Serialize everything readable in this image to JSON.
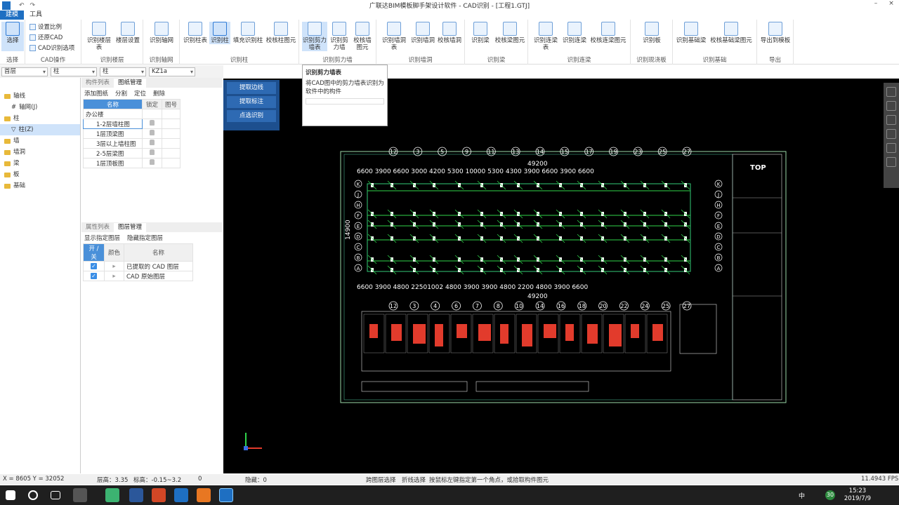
{
  "window": {
    "title": "广联达BIM模板脚手架设计软件 - CAD识别 - [工程1.GTJ]",
    "quick_access": [
      "↶",
      "↷"
    ],
    "controls": [
      "–",
      "×"
    ]
  },
  "menu": {
    "tabs": [
      "建模",
      "工具"
    ]
  },
  "ribbon": {
    "select": {
      "label": "选择",
      "group": "选择"
    },
    "cad_ops": {
      "items": [
        "设置比例",
        "还原CAD",
        "CAD识别选项"
      ],
      "group": "CAD操作"
    },
    "floor": {
      "buttons": [
        "识别楼层表",
        "楼层设置"
      ],
      "group": "识别楼层"
    },
    "axis": {
      "buttons": [
        "识别轴网"
      ],
      "group": "识别轴网"
    },
    "column": {
      "buttons": [
        "识别柱表",
        "识别柱",
        "填充识别柱",
        "校核柱图元"
      ],
      "group": "识别柱"
    },
    "shearwall": {
      "buttons": [
        "识别剪力墙表",
        "识别剪力墙",
        "校核墙图元"
      ],
      "group": "识别剪力墙"
    },
    "wallhole": {
      "buttons": [
        "识别墙洞表",
        "识别墙洞",
        "校核墙洞"
      ],
      "group": "识别墙洞"
    },
    "beam": {
      "buttons": [
        "识别梁",
        "校核梁图元"
      ],
      "group": "识别梁"
    },
    "lianliang": {
      "buttons": [
        "识别连梁表",
        "识别连梁",
        "校核连梁图元"
      ],
      "group": "识别连梁"
    },
    "slab": {
      "buttons": [
        "识别板"
      ],
      "group": "识别现浇板"
    },
    "foundation": {
      "buttons": [
        "识别基础梁",
        "校核基础梁图元"
      ],
      "group": "识别基础"
    },
    "export": {
      "buttons": [
        "导出到模板"
      ],
      "group": "导出"
    }
  },
  "filters": {
    "floor": "首层",
    "type1": "柱",
    "type2": "柱",
    "name": "KZ1a"
  },
  "tree": {
    "items": [
      {
        "label": "轴线",
        "child": false
      },
      {
        "label": "轴网(J)",
        "child": true
      },
      {
        "label": "柱",
        "child": false
      },
      {
        "label": "柱(Z)",
        "child": true,
        "selected": true
      },
      {
        "label": "墙",
        "child": false
      },
      {
        "label": "墙洞",
        "child": false
      },
      {
        "label": "梁",
        "child": false
      },
      {
        "label": "板",
        "child": false
      },
      {
        "label": "基础",
        "child": false
      }
    ]
  },
  "drawing_panel": {
    "tabs": [
      "构件列表",
      "图纸管理"
    ],
    "tools": [
      "添加图纸",
      "分割",
      "定位",
      "删除"
    ],
    "headers": [
      "名称",
      "锁定",
      "图号"
    ],
    "group": "办公楼",
    "rows": [
      "1-2层墙柱图",
      "1层顶梁图",
      "3层以上墙柱图",
      "2-5层梁图",
      "1层顶板图"
    ]
  },
  "layer_panel": {
    "tabs": [
      "属性列表",
      "图层管理"
    ],
    "options": [
      "显示指定图层",
      "隐藏指定图层"
    ],
    "headers": [
      "开 / 关",
      "颜色",
      "名称"
    ],
    "rows": [
      "已提取的 CAD 图层",
      "CAD 原始图层"
    ]
  },
  "float_panel": {
    "buttons": [
      "提取边线",
      "提取标注",
      "点选识别"
    ]
  },
  "tooltip": {
    "title": "识别剪力墙表",
    "body": "将CAD图中的剪力墙表识别为软件中的构件"
  },
  "drawing": {
    "top_axes": [
      "12",
      "3",
      "5",
      "9",
      "11",
      "13",
      "14",
      "15",
      "17",
      "19",
      "23",
      "25",
      "27"
    ],
    "bottom_axes": [
      "12",
      "3",
      "4",
      "6",
      "7",
      "8",
      "10",
      "14",
      "16",
      "18",
      "20",
      "22",
      "24",
      "25",
      "27"
    ],
    "total": "49200",
    "side_axes": [
      "K",
      "J",
      "H",
      "F",
      "E",
      "D",
      "C",
      "B",
      "A"
    ],
    "logo": "TOP",
    "dims": [
      "6600",
      "3900",
      "6600",
      "3000",
      "4200",
      "5300",
      "10000",
      "5300",
      "4300",
      "3900",
      "6600",
      "3900",
      "6600"
    ],
    "dims_bottom": [
      "6600",
      "3900",
      "4800",
      "2250",
      "0",
      "1",
      "0",
      "0",
      "1",
      "0",
      "0",
      "2250",
      "0",
      "4800",
      "3900",
      "3900",
      "4800",
      "2200",
      "0",
      "0",
      "1",
      "0",
      "0",
      "2250",
      "0",
      "4800",
      "3900",
      "6600"
    ],
    "left_dims": "14900"
  },
  "status": {
    "coords": "X = 8605 Y = 32052",
    "floor_height": "层高：3.35",
    "elevation": "标高：-0.15~3.2",
    "zero": "0",
    "hidden": "隐藏：0",
    "cross_layer": "跨图层选择",
    "polyline": "折线选择",
    "hint": "按鼠标左键指定第一个角点，或拾取构件图元",
    "fps": "11.4943 FPS"
  },
  "taskbar": {
    "time": "15:23",
    "date": "2019/7/9",
    "ime": "中",
    "badge": "30"
  },
  "colors": {
    "accent": "#1e6fc2",
    "canvas": "#000000",
    "cad_green": "#2fd34a",
    "cad_red": "#e23b2c"
  }
}
